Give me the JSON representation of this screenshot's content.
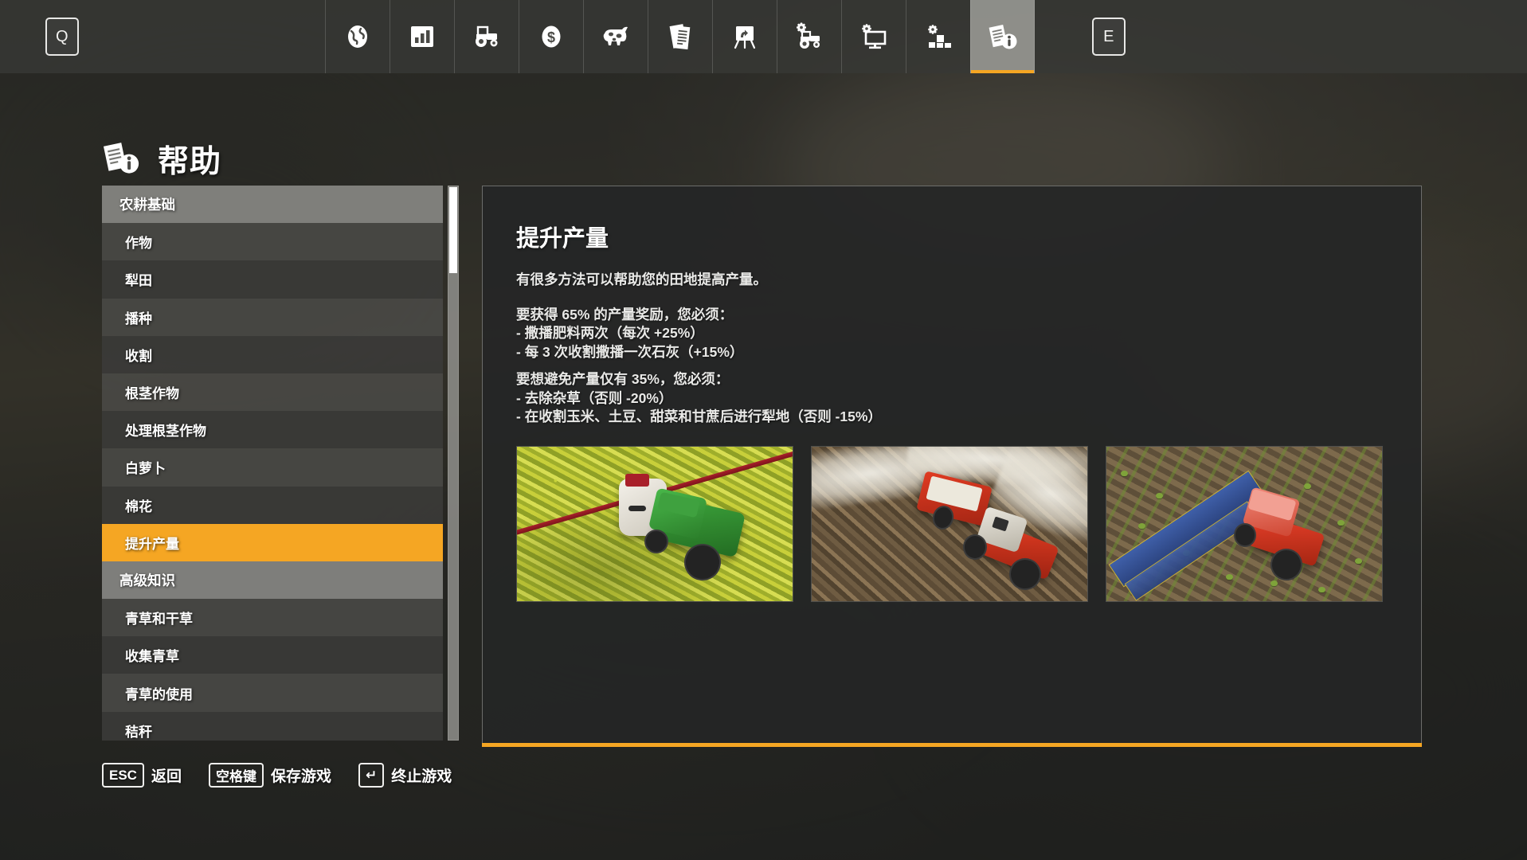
{
  "topbar": {
    "left_key": "Q",
    "right_key": "E",
    "tabs": [
      {
        "icon": "globe-icon",
        "name": "map",
        "active": false
      },
      {
        "icon": "bar-chart-icon",
        "name": "statistics",
        "active": false
      },
      {
        "icon": "tractor-icon",
        "name": "vehicles",
        "active": false
      },
      {
        "icon": "dollar-coin-icon",
        "name": "finances",
        "active": false
      },
      {
        "icon": "cow-icon",
        "name": "animals",
        "active": false
      },
      {
        "icon": "documents-icon",
        "name": "contracts",
        "active": false
      },
      {
        "icon": "easel-chart-icon",
        "name": "prices",
        "active": false
      },
      {
        "icon": "tractor-gear-icon",
        "name": "vehicle-config",
        "active": false
      },
      {
        "icon": "monitor-gear-icon",
        "name": "game-settings",
        "active": false
      },
      {
        "icon": "blocks-gear-icon",
        "name": "mods",
        "active": false
      },
      {
        "icon": "document-info-icon",
        "name": "help",
        "active": true
      }
    ]
  },
  "page": {
    "title": "帮助",
    "title_icon": "document-info-icon"
  },
  "sidebar": {
    "items": [
      {
        "label": "农耕基础",
        "type": "header",
        "selected": false
      },
      {
        "label": "作物",
        "type": "item",
        "selected": false
      },
      {
        "label": "犁田",
        "type": "item",
        "selected": false
      },
      {
        "label": "播种",
        "type": "item",
        "selected": false
      },
      {
        "label": "收割",
        "type": "item",
        "selected": false
      },
      {
        "label": "根茎作物",
        "type": "item",
        "selected": false
      },
      {
        "label": "处理根茎作物",
        "type": "item",
        "selected": false
      },
      {
        "label": "白萝卜",
        "type": "item",
        "selected": false
      },
      {
        "label": "棉花",
        "type": "item",
        "selected": false
      },
      {
        "label": "提升产量",
        "type": "item",
        "selected": true
      },
      {
        "label": "高级知识",
        "type": "header",
        "selected": false
      },
      {
        "label": "青草和干草",
        "type": "item",
        "selected": false
      },
      {
        "label": "收集青草",
        "type": "item",
        "selected": false
      },
      {
        "label": "青草的使用",
        "type": "item",
        "selected": false
      },
      {
        "label": "秸秆",
        "type": "item",
        "selected": false
      }
    ],
    "scroll_position_percent": 4
  },
  "content": {
    "title": "提升产量",
    "intro": "有很多方法可以帮助您的田地提高产量。",
    "bonus_heading": "要获得 65% 的产量奖励，您必须：",
    "bonus_lines": [
      "- 撒播肥料两次（每次 +25%）",
      "- 每 3 次收割撒播一次石灰（+15%）"
    ],
    "penalty_heading": "要想避免产量仅有 35%，您必须：",
    "penalty_lines": [
      "- 去除杂草（否则 -20%）",
      "- 在收割玉米、土豆、甜菜和甘蔗后进行犁地（否则 -15%）"
    ],
    "images": [
      {
        "name": "sprayer-in-canola-field-image",
        "alt": "绿色拖拉机在油菜田中喷洒肥料"
      },
      {
        "name": "lime-spreader-on-soil-image",
        "alt": "红色拖拉机在耕地上撒播石灰"
      },
      {
        "name": "weeder-on-young-crop-image",
        "alt": "红色拖拉机牵引蓝色除草机作业"
      }
    ]
  },
  "helpbar": {
    "entries": [
      {
        "key": "ESC",
        "label": "返回"
      },
      {
        "key": "空格键",
        "label": "保存游戏"
      },
      {
        "key": "↵",
        "label": "终止游戏"
      }
    ]
  },
  "colors": {
    "accent_orange": "#f5a623",
    "panel_bg": "#252626",
    "topbar_bg": "#343531",
    "header_row": "#8b8b87",
    "row_odd": "#4a4a47",
    "row_even": "#3b3b39"
  }
}
